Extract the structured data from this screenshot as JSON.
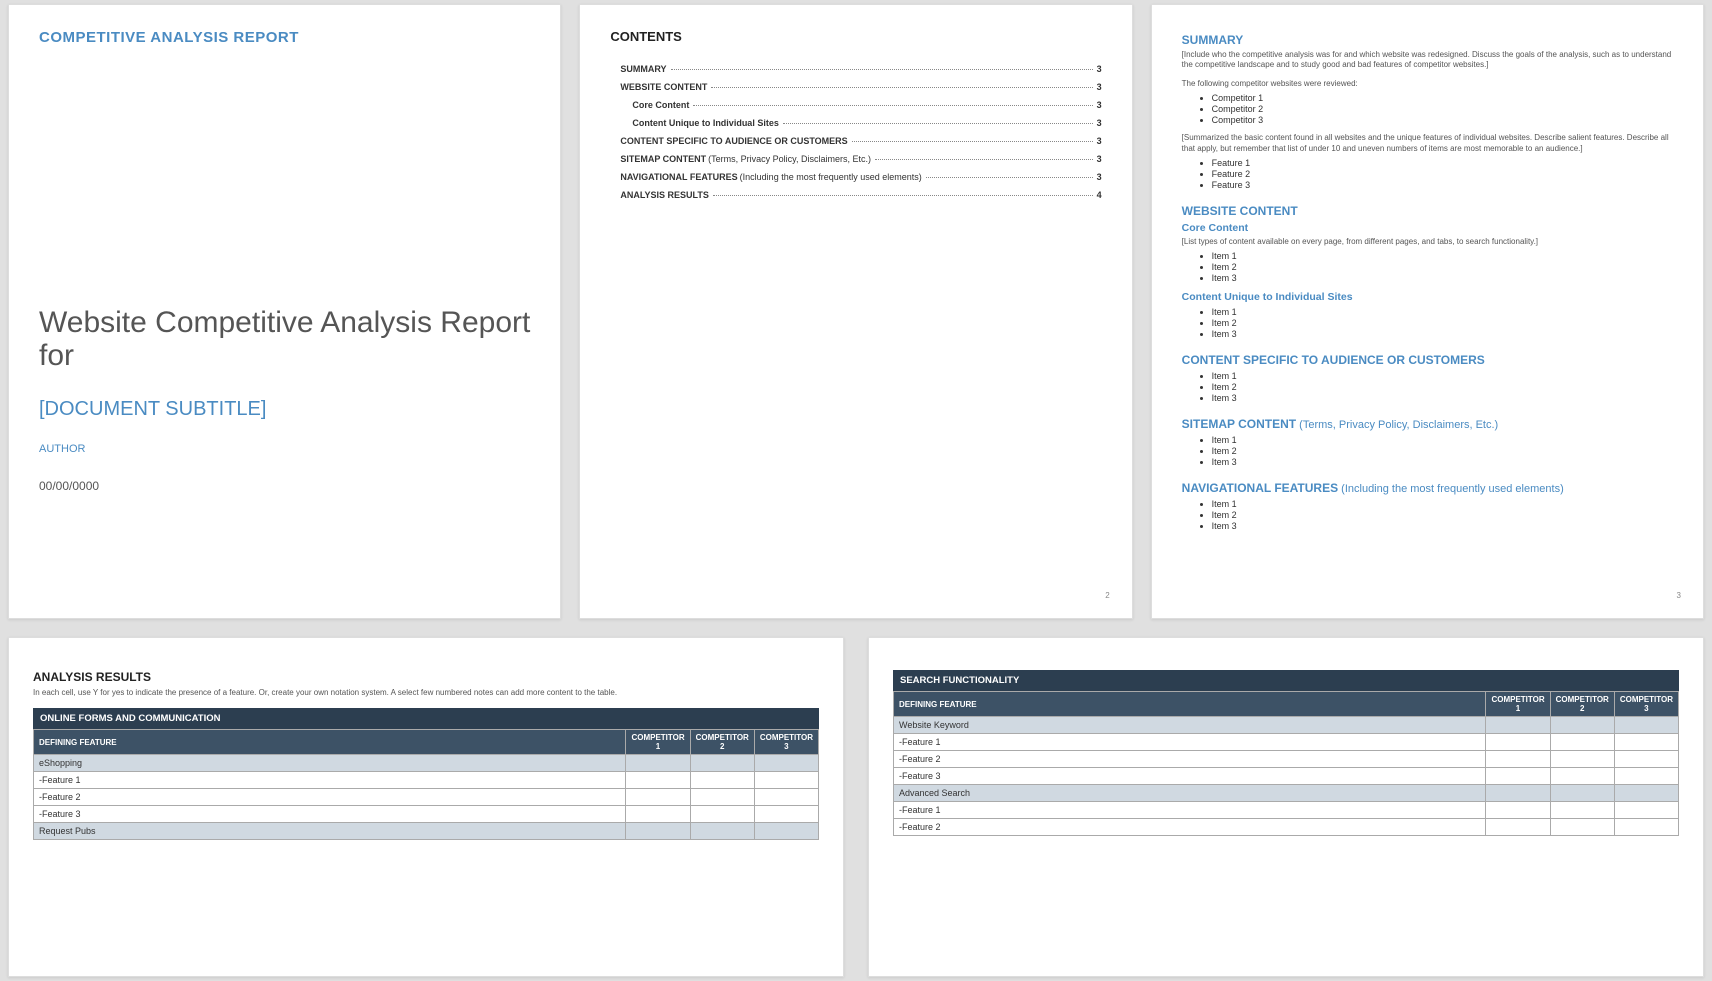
{
  "page1": {
    "header": "COMPETITIVE ANALYSIS REPORT",
    "title": "Website Competitive Analysis Report for",
    "subtitle": "[DOCUMENT SUBTITLE]",
    "author": "AUTHOR",
    "date": "00/00/0000"
  },
  "page2": {
    "title": "CONTENTS",
    "toc": [
      {
        "label": "SUMMARY",
        "page": "3",
        "bold": true
      },
      {
        "label": "WEBSITE CONTENT",
        "page": "3",
        "bold": true
      },
      {
        "label": "Core Content",
        "page": "3",
        "sub": true
      },
      {
        "label": "Content Unique to Individual Sites",
        "page": "3",
        "sub": true
      },
      {
        "label": "CONTENT SPECIFIC TO AUDIENCE OR CUSTOMERS",
        "page": "3",
        "bold": true
      },
      {
        "label": "SITEMAP CONTENT",
        "note": " (Terms, Privacy Policy, Disclaimers, Etc.)",
        "page": "3",
        "bold": true
      },
      {
        "label": "NAVIGATIONAL FEATURES",
        "note": " (Including the most frequently used elements)",
        "page": "3",
        "bold": true
      },
      {
        "label": "ANALYSIS RESULTS",
        "page": "4",
        "bold": true
      }
    ],
    "pgnum": "2"
  },
  "page3": {
    "summary_h": "SUMMARY",
    "summary_t1": "[Include who the competitive analysis was for and which website was redesigned. Discuss the goals of the analysis, such as to understand the competitive landscape and to study good and bad features of competitor websites.]",
    "summary_t2": "The following competitor websites were reviewed:",
    "competitors": [
      "Competitor 1",
      "Competitor 2",
      "Competitor 3"
    ],
    "summary_t3": "[Summarized the basic content found in all websites and the unique features of individual websites. Describe salient features. Describe all that apply, but remember that list of under 10 and uneven numbers of items are most memorable to an audience.]",
    "features": [
      "Feature 1",
      "Feature 2",
      "Feature 3"
    ],
    "wc_h": "WEBSITE CONTENT",
    "core_h": "Core Content",
    "core_t": "[List types of content available on every page, from different pages, and tabs, to search functionality.]",
    "core_items": [
      "Item 1",
      "Item 2",
      "Item 3"
    ],
    "unique_h": "Content Unique to Individual Sites",
    "unique_items": [
      "Item 1",
      "Item 2",
      "Item 3"
    ],
    "audience_h": "CONTENT SPECIFIC TO AUDIENCE OR CUSTOMERS",
    "audience_items": [
      "Item 1",
      "Item 2",
      "Item 3"
    ],
    "sitemap_h": "SITEMAP CONTENT",
    "sitemap_n": " (Terms, Privacy Policy, Disclaimers, Etc.)",
    "sitemap_items": [
      "Item 1",
      "Item 2",
      "Item 3"
    ],
    "nav_h": "NAVIGATIONAL FEATURES",
    "nav_n": " (Including the most frequently used elements)",
    "nav_items": [
      "Item 1",
      "Item 2",
      "Item 3"
    ],
    "pgnum": "3"
  },
  "page4": {
    "title": "ANALYSIS RESULTS",
    "desc": "In each cell, use Y for yes to indicate the presence of a feature. Or, create your own notation system. A select few numbered notes can add more content to the table.",
    "tbltitle": "ONLINE FORMS AND COMMUNICATION",
    "cols": [
      "DEFINING FEATURE",
      "COMPETITOR 1",
      "COMPETITOR 2",
      "COMPETITOR 3"
    ],
    "rows": [
      {
        "g": true,
        "label": "eShopping"
      },
      {
        "label": "-Feature 1"
      },
      {
        "label": "-Feature 2"
      },
      {
        "label": "-Feature 3"
      },
      {
        "g": true,
        "label": "Request Pubs"
      }
    ]
  },
  "page5": {
    "tbltitle": "SEARCH FUNCTIONALITY",
    "cols": [
      "DEFINING FEATURE",
      "COMPETITOR 1",
      "COMPETITOR 2",
      "COMPETITOR 3"
    ],
    "rows": [
      {
        "g": true,
        "label": "Website Keyword"
      },
      {
        "label": "-Feature 1"
      },
      {
        "label": "-Feature 2"
      },
      {
        "label": "-Feature 3"
      },
      {
        "g": true,
        "label": "Advanced Search"
      },
      {
        "label": "-Feature 1"
      },
      {
        "label": "-Feature 2"
      }
    ]
  }
}
